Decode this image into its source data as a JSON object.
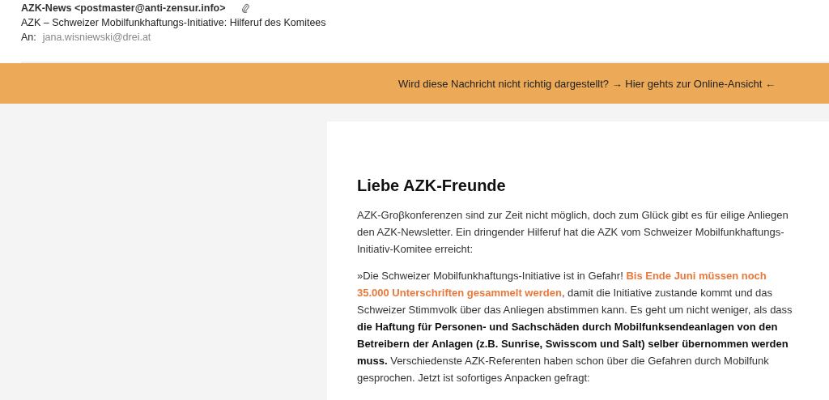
{
  "header": {
    "sender": "AZK-News <postmaster@anti-zensur.info>",
    "attachment": true,
    "subject": "AZK – Schweizer Mobilfunkhaftungs-Initiative: Hilferuf des Komitees",
    "to_label": "An:",
    "to": "jana.wisniewski@drei.at"
  },
  "banner": {
    "text": "Wird diese Nachricht nicht richtig dargestellt? → Hier gehts zur Online-Ansicht ←"
  },
  "body": {
    "heading": "Liebe AZK-Freunde",
    "paragraphs": [
      [
        {
          "kind": "plain",
          "text": "AZK-Groβkonferenzen sind zur Zeit nicht möglich, doch zum Glück gibt es für eilige Anliegen den AZK-Newsletter. Ein dringender Hilferuf hat die AZK vom Schweizer Mobilfunkhaftungs-Initiativ-Komitee erreicht:"
        }
      ],
      [
        {
          "kind": "plain",
          "text": "»Die Schweizer Mobilfunkhaftungs-Initiative ist in Gefahr! "
        },
        {
          "kind": "highlight",
          "text": "Bis Ende Juni müssen noch 35.000 Unterschriften gesammelt werden"
        },
        {
          "kind": "plain",
          "text": ", damit die Initiative zustande kommt und das Schweizer Stimmvolk über das Anliegen abstimmen kann. Es geht um nicht weniger, als dass "
        },
        {
          "kind": "bold",
          "text": "die Haftung für Personen- und Sachschäden durch  Mobilfunksendeanlagen von den Betreibern der Anlagen (z.B. Sunrise, Swisscom und Salt) selber übernommen werden muss."
        },
        {
          "kind": "plain",
          "text": " Verschiedenste AZK-Referenten haben schon über die Gefahren durch Mobilfunk gesprochen. Jetzt ist sofortiges Anpacken gefragt:"
        }
      ]
    ]
  }
}
